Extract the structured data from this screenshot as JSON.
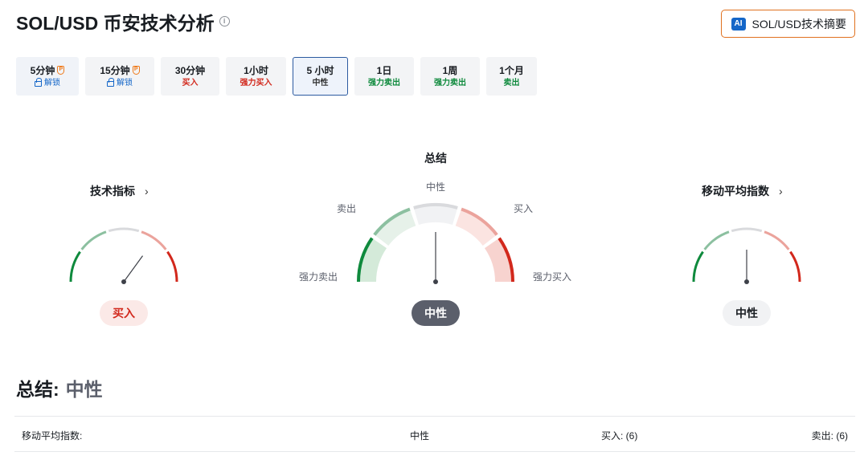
{
  "header": {
    "title": "SOL/USD 币安技术分析",
    "info_glyph": "i",
    "ai_badge": "AI",
    "ai_button": "SOL/USD技术摘要"
  },
  "tabs": [
    {
      "label": "5分钟",
      "sub": "解锁",
      "pro": true,
      "locked": true,
      "signal": "lock"
    },
    {
      "label": "15分钟",
      "sub": "解锁",
      "pro": true,
      "locked": true,
      "signal": "lock"
    },
    {
      "label": "30分钟",
      "sub": "买入",
      "signal": "buy"
    },
    {
      "label": "1小时",
      "sub": "强力买入",
      "signal": "buy"
    },
    {
      "label": "5 小时",
      "sub": "中性",
      "signal": "neutral",
      "active": true
    },
    {
      "label": "1日",
      "sub": "强力卖出",
      "signal": "sell"
    },
    {
      "label": "1周",
      "sub": "强力卖出",
      "signal": "sell"
    },
    {
      "label": "1个月",
      "sub": "卖出",
      "signal": "sell"
    }
  ],
  "gauges": {
    "left": {
      "title": "技术指标",
      "chevron": "›",
      "result": "买入",
      "needle_level": 0.7
    },
    "center": {
      "title": "总结",
      "result": "中性",
      "needle_level": 0.5,
      "labels": {
        "strong_sell": "强力卖出",
        "sell": "卖出",
        "neutral": "中性",
        "buy": "买入",
        "strong_buy": "强力买入"
      }
    },
    "right": {
      "title": "移动平均指数",
      "chevron": "›",
      "result": "中性",
      "needle_level": 0.5
    }
  },
  "colors": {
    "strong_sell": "#0f8a3d",
    "sell": "#8cc0a0",
    "neutral": "#d9dadd",
    "buy": "#eba39c",
    "strong_buy": "#d2281c"
  },
  "summary": {
    "label": "总结:",
    "value": "中性",
    "rows": [
      {
        "name": "移动平均指数:",
        "status": "中性",
        "buy": "买入: (6)",
        "sell": "卖出: (6)"
      }
    ]
  }
}
